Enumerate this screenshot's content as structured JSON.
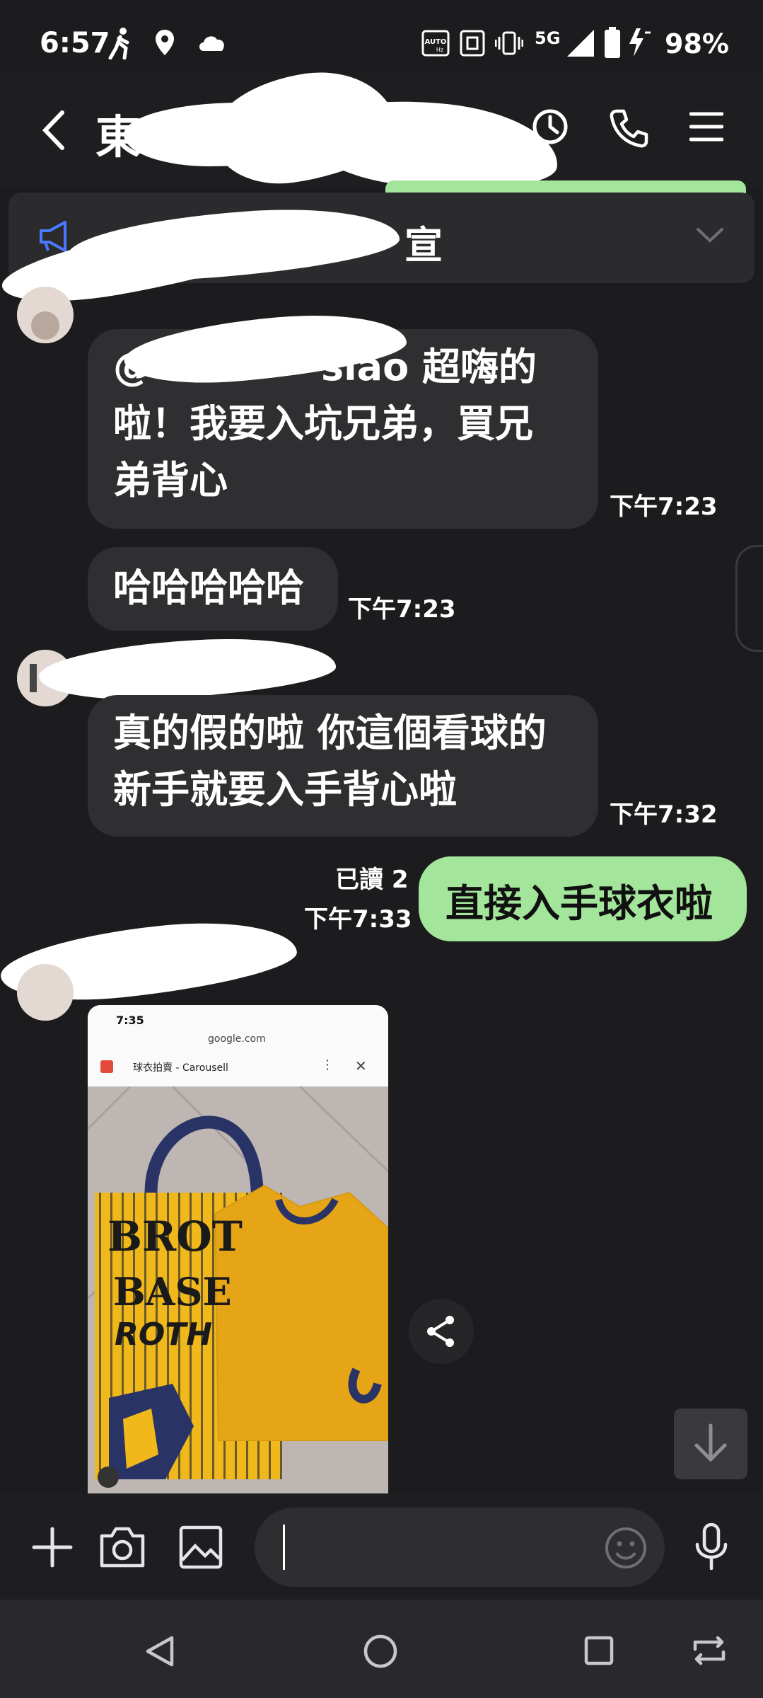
{
  "status_bar": {
    "time": "6:57",
    "network": "5G",
    "battery": "98%",
    "icons": [
      "walking-icon",
      "location-icon",
      "cloud-icon",
      "auto-hz-icon",
      "nfc-icon",
      "vibrate-icon",
      "signal-icon",
      "battery-icon",
      "charging-icon"
    ]
  },
  "header": {
    "title_visible": "東",
    "icons": [
      "back-icon",
      "clock-icon",
      "phone-icon",
      "menu-icon"
    ]
  },
  "announcement": {
    "text_visible": "宣",
    "icons": [
      "megaphone-icon",
      "chevron-down-icon"
    ]
  },
  "messages": [
    {
      "text_line1": "@",
      "text_line1b": "siao 超嗨的",
      "text_line2": "啦！我要入坑兄弟，買兄",
      "text_line3": "弟背心",
      "time": "下午7:23"
    },
    {
      "text": "哈哈哈哈哈",
      "time": "下午7:23"
    },
    {
      "text_line1": "真的假的啦 你這個看球的",
      "text_line2": "新手就要入手背心啦",
      "time": "下午7:32"
    },
    {
      "text": "直接入手球衣啦",
      "read": "已讀 2",
      "time": "下午7:33"
    }
  ],
  "image_message": {
    "phone_time": "7:35",
    "url": "google.com",
    "page_title": "球衣拍賣 - Carousell",
    "bag_text1": "BROT",
    "bag_text2": "BASE",
    "bag_text3": "ROTH"
  },
  "input_bar": {
    "icons": [
      "plus-icon",
      "camera-icon",
      "image-icon",
      "emoji-icon",
      "mic-icon"
    ],
    "placeholder": ""
  },
  "nav_bar": {
    "icons": [
      "nav-back-icon",
      "nav-home-icon",
      "nav-recents-icon",
      "rotate-icon"
    ]
  },
  "colors": {
    "background": "#1c1c1e",
    "bubble_incoming": "#2f2f31",
    "bubble_outgoing": "#a3e59b",
    "jersey_yellow": "#f0b81a",
    "navy": "#2a3366"
  }
}
